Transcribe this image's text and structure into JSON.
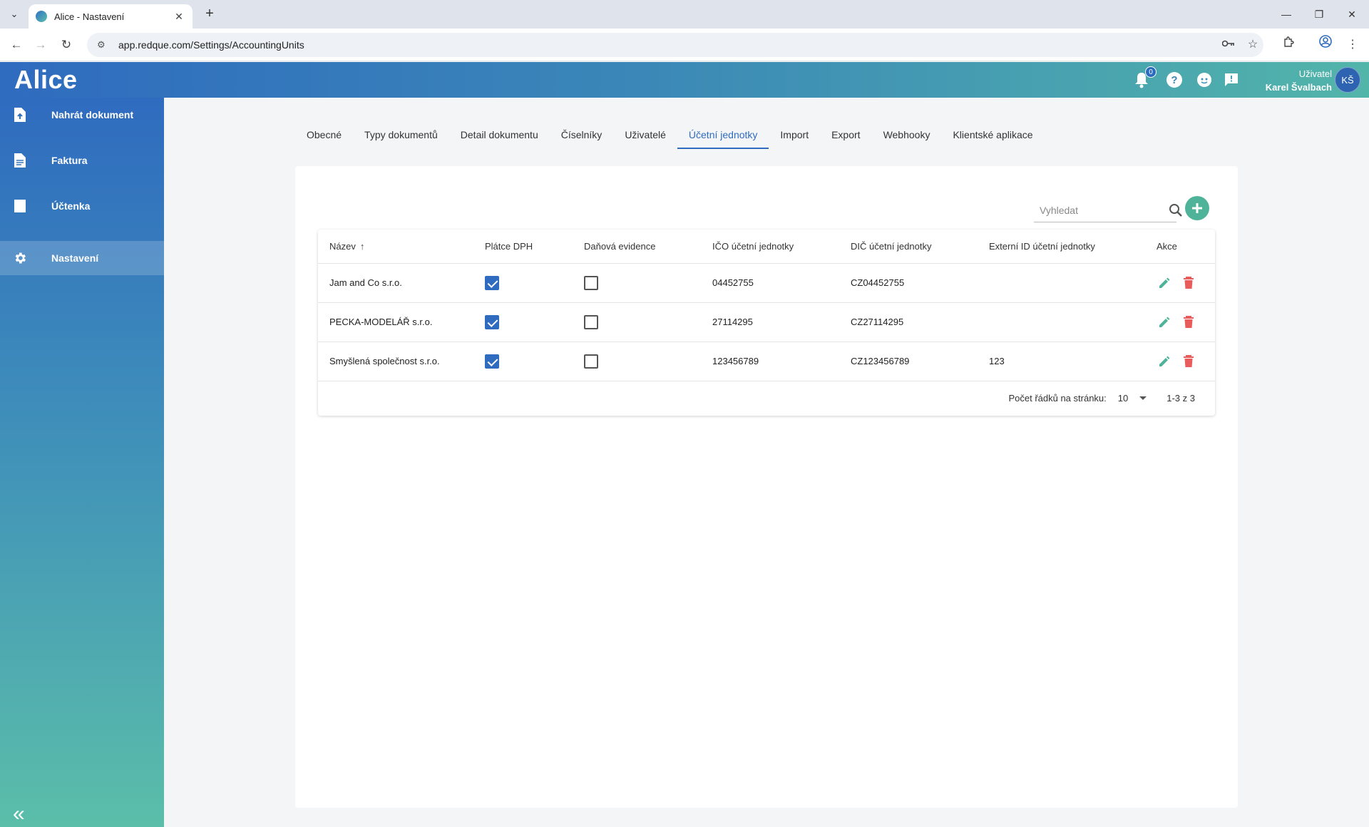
{
  "browser": {
    "tab_title": "Alice - Nastavení",
    "url": "app.redque.com/Settings/AccountingUnits"
  },
  "header": {
    "logo": "Alice",
    "notification_count": "0",
    "user_label": "Uživatel",
    "user_name": "Karel Švalbach",
    "avatar_initials": "KŠ"
  },
  "sidebar": {
    "items": [
      {
        "label": "Nahrát dokument",
        "icon": "upload-file-icon"
      },
      {
        "label": "Faktura",
        "icon": "document-icon"
      },
      {
        "label": "Účtenka",
        "icon": "receipt-icon"
      },
      {
        "label": "Nastavení",
        "icon": "gear-icon",
        "active": true
      }
    ]
  },
  "tabs": [
    {
      "label": "Obecné"
    },
    {
      "label": "Typy dokumentů"
    },
    {
      "label": "Detail dokumentu"
    },
    {
      "label": "Číselníky"
    },
    {
      "label": "Uživatelé"
    },
    {
      "label": "Účetní jednotky",
      "active": true
    },
    {
      "label": "Import"
    },
    {
      "label": "Export"
    },
    {
      "label": "Webhooky"
    },
    {
      "label": "Klientské aplikace"
    }
  ],
  "search": {
    "placeholder": "Vyhledat"
  },
  "table": {
    "columns": [
      "Název",
      "Plátce DPH",
      "Daňová evidence",
      "IČO účetní jednotky",
      "DIČ účetní jednotky",
      "Externí ID účetní jednotky",
      "Akce"
    ],
    "rows": [
      {
        "name": "Jam and Co s.r.o.",
        "vat_payer": true,
        "tax_records": false,
        "ico": "04452755",
        "dic": "CZ04452755",
        "external_id": ""
      },
      {
        "name": "PECKA-MODELÁŘ s.r.o.",
        "vat_payer": true,
        "tax_records": false,
        "ico": "27114295",
        "dic": "CZ27114295",
        "external_id": ""
      },
      {
        "name": "Smyšlená společnost s.r.o.",
        "vat_payer": true,
        "tax_records": false,
        "ico": "123456789",
        "dic": "CZ123456789",
        "external_id": "123"
      }
    ]
  },
  "pagination": {
    "rows_per_page_label": "Počet řádků na stránku:",
    "rows_per_page": "10",
    "range": "1-3 z 3"
  },
  "colors": {
    "primary": "#2f6bbf",
    "accent": "#4fb39a",
    "edit": "#4fb39a",
    "delete": "#e85c5c"
  }
}
